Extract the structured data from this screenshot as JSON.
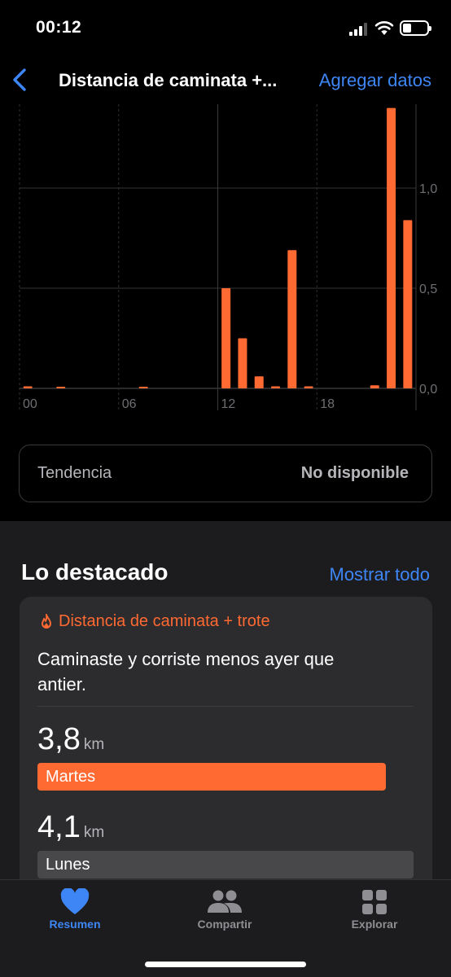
{
  "status_bar": {
    "time": "00:12",
    "battery_level": 0.35
  },
  "nav": {
    "back_icon": "chevron-left-icon",
    "title": "Distancia de caminata +...",
    "action_label": "Agregar datos"
  },
  "colors": {
    "accent_blue": "#3e86f5",
    "bar_orange": "#ff6932",
    "background": "#000000",
    "card_background": "#2c2c2e"
  },
  "chart_data": {
    "type": "bar",
    "xlabel": "",
    "ylabel": "",
    "x_tick_labels": [
      "00",
      "06",
      "12",
      "18"
    ],
    "y_tick_labels": [
      "1,0",
      "0,5",
      "0,0"
    ],
    "ylim": [
      0,
      1.4
    ],
    "grid": true,
    "categories": [
      "00",
      "01",
      "02",
      "03",
      "04",
      "05",
      "06",
      "07",
      "08",
      "09",
      "10",
      "11",
      "12",
      "13",
      "14",
      "15",
      "16",
      "17",
      "18",
      "19",
      "20",
      "21",
      "22",
      "23"
    ],
    "values": [
      0.01,
      0,
      0.003,
      0,
      0,
      0,
      0,
      0.003,
      0,
      0,
      0,
      0,
      0.5,
      0.25,
      0.06,
      0.01,
      0.69,
      0.01,
      0,
      0,
      0,
      0.015,
      1.4,
      0.84
    ]
  },
  "trend": {
    "label": "Tendencia",
    "value": "No disponible"
  },
  "highlights": {
    "title": "Lo destacado",
    "show_all_label": "Mostrar todo",
    "card": {
      "icon": "flame-icon",
      "category": "Distancia de caminata + trote",
      "description": "Caminaste y corriste menos ayer que antier.",
      "metrics": [
        {
          "value": "3,8",
          "unit": "km",
          "day": "Martes",
          "fraction": 0.927,
          "color": "#ff6932"
        },
        {
          "value": "4,1",
          "unit": "km",
          "day": "Lunes",
          "fraction": 1.0,
          "color": "#48484a"
        }
      ]
    }
  },
  "tab_bar": {
    "tabs": [
      {
        "label": "Resumen",
        "icon": "heart-icon",
        "active": true
      },
      {
        "label": "Compartir",
        "icon": "people-icon",
        "active": false
      },
      {
        "label": "Explorar",
        "icon": "grid-icon",
        "active": false
      }
    ]
  }
}
